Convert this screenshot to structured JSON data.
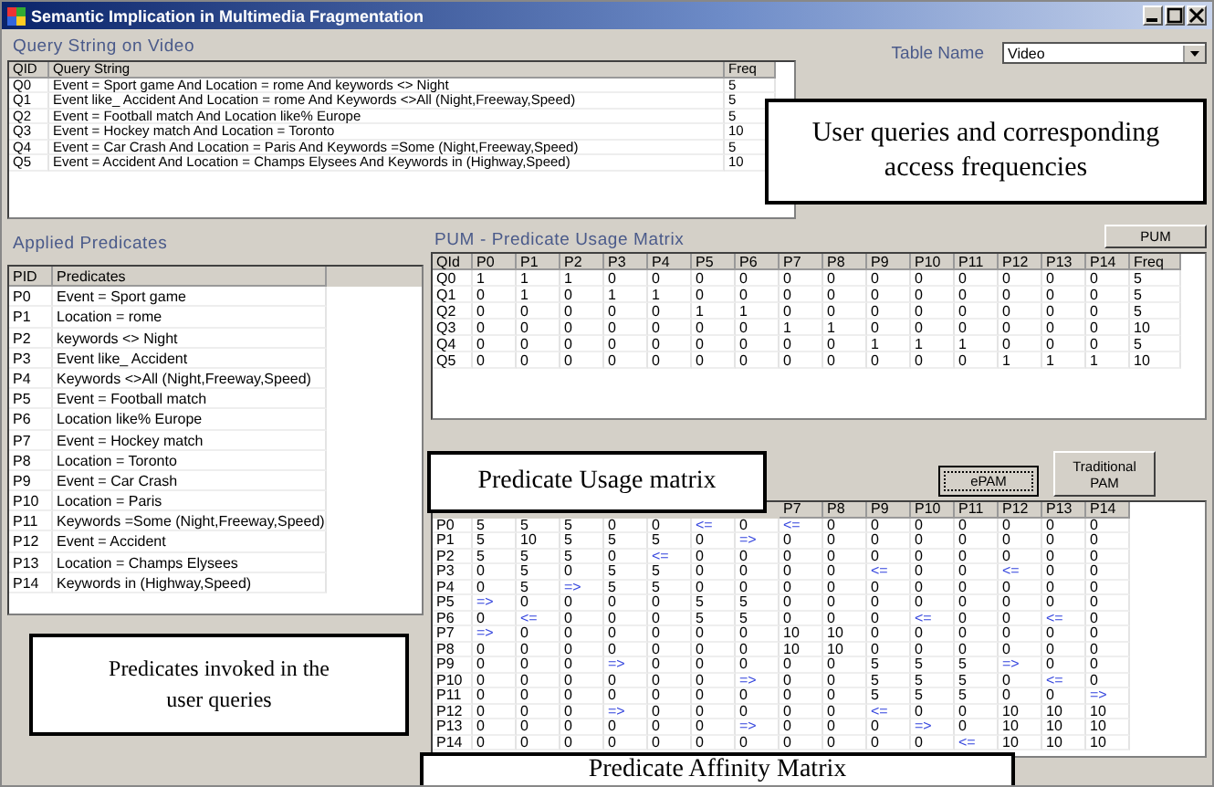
{
  "window": {
    "title": "Semantic Implication in Multimedia Fragmentation"
  },
  "query_section": {
    "title": "Query String on Video",
    "columns": [
      "QID",
      "Query String",
      "Freq"
    ],
    "rows": [
      [
        "Q0",
        "Event = Sport game And Location = rome And keywords <> Night",
        "5"
      ],
      [
        "Q1",
        "Event like_ Accident And Location = rome And  Keywords <>All (Night,Freeway,Speed)",
        "5"
      ],
      [
        "Q2",
        "Event = Football match And Location like% Europe",
        "5"
      ],
      [
        "Q3",
        "Event = Hockey match And Location = Toronto",
        "10"
      ],
      [
        "Q4",
        "Event = Car Crash And Location = Paris And  Keywords =Some (Night,Freeway,Speed)",
        "5"
      ],
      [
        "Q5",
        "Event = Accident And Location = Champs Elysees And Keywords in (Highway,Speed)",
        "10"
      ]
    ]
  },
  "table_name": {
    "label": "Table Name",
    "value": "Video"
  },
  "predicates_section": {
    "title": "Applied Predicates",
    "columns": [
      "PID",
      "Predicates"
    ],
    "rows": [
      [
        "P0",
        "Event = Sport game"
      ],
      [
        "P1",
        "Location = rome"
      ],
      [
        "P2",
        "keywords <> Night"
      ],
      [
        "P3",
        "Event like_ Accident"
      ],
      [
        "P4",
        "Keywords <>All (Night,Freeway,Speed)"
      ],
      [
        "P5",
        "Event = Football match"
      ],
      [
        "P6",
        "Location like% Europe"
      ],
      [
        "P7",
        "Event = Hockey match"
      ],
      [
        "P8",
        "Location = Toronto"
      ],
      [
        "P9",
        "Event = Car Crash"
      ],
      [
        "P10",
        "Location = Paris"
      ],
      [
        "P11",
        "Keywords =Some (Night,Freeway,Speed)"
      ],
      [
        "P12",
        "Event = Accident"
      ],
      [
        "P13",
        "Location = Champs Elysees"
      ],
      [
        "P14",
        "Keywords in (Highway,Speed)"
      ]
    ]
  },
  "pum_section": {
    "title": "PUM - Predicate Usage Matrix",
    "button": "PUM",
    "columns": [
      "QId",
      "P0",
      "P1",
      "P2",
      "P3",
      "P4",
      "P5",
      "P6",
      "P7",
      "P8",
      "P9",
      "P10",
      "P11",
      "P12",
      "P13",
      "P14",
      "Freq"
    ],
    "rows": [
      [
        "Q0",
        "1",
        "1",
        "1",
        "0",
        "0",
        "0",
        "0",
        "0",
        "0",
        "0",
        "0",
        "0",
        "0",
        "0",
        "0",
        "5"
      ],
      [
        "Q1",
        "0",
        "1",
        "0",
        "1",
        "1",
        "0",
        "0",
        "0",
        "0",
        "0",
        "0",
        "0",
        "0",
        "0",
        "0",
        "5"
      ],
      [
        "Q2",
        "0",
        "0",
        "0",
        "0",
        "0",
        "1",
        "1",
        "0",
        "0",
        "0",
        "0",
        "0",
        "0",
        "0",
        "0",
        "5"
      ],
      [
        "Q3",
        "0",
        "0",
        "0",
        "0",
        "0",
        "0",
        "0",
        "1",
        "1",
        "0",
        "0",
        "0",
        "0",
        "0",
        "0",
        "10"
      ],
      [
        "Q4",
        "0",
        "0",
        "0",
        "0",
        "0",
        "0",
        "0",
        "0",
        "0",
        "1",
        "1",
        "1",
        "0",
        "0",
        "0",
        "5"
      ],
      [
        "Q5",
        "0",
        "0",
        "0",
        "0",
        "0",
        "0",
        "0",
        "0",
        "0",
        "0",
        "0",
        "0",
        "1",
        "1",
        "1",
        "10"
      ]
    ]
  },
  "buttons": [
    "ePAM",
    "Traditional PAM"
  ],
  "pam_section": {
    "visible_columns": [
      "P7",
      "P8",
      "P9",
      "P10",
      "P11",
      "P12",
      "P13",
      "P14"
    ],
    "rows": [
      [
        "P0",
        "5",
        "5",
        "5",
        "0",
        "0",
        "<=",
        "0",
        "<=",
        "0",
        "0",
        "0",
        "0",
        "0",
        "0",
        "0"
      ],
      [
        "P1",
        "5",
        "10",
        "5",
        "5",
        "5",
        "0",
        "=>",
        "0",
        "0",
        "0",
        "0",
        "0",
        "0",
        "0",
        "0"
      ],
      [
        "P2",
        "5",
        "5",
        "5",
        "0",
        "<=",
        "0",
        "0",
        "0",
        "0",
        "0",
        "0",
        "0",
        "0",
        "0",
        "0"
      ],
      [
        "P3",
        "0",
        "5",
        "0",
        "5",
        "5",
        "0",
        "0",
        "0",
        "0",
        "<=",
        "0",
        "0",
        "<=",
        "0",
        "0"
      ],
      [
        "P4",
        "0",
        "5",
        "=>",
        "5",
        "5",
        "0",
        "0",
        "0",
        "0",
        "0",
        "0",
        "0",
        "0",
        "0",
        "0"
      ],
      [
        "P5",
        "=>",
        "0",
        "0",
        "0",
        "0",
        "5",
        "5",
        "0",
        "0",
        "0",
        "0",
        "0",
        "0",
        "0",
        "0"
      ],
      [
        "P6",
        "0",
        "<=",
        "0",
        "0",
        "0",
        "5",
        "5",
        "0",
        "0",
        "0",
        "<=",
        "0",
        "0",
        "<=",
        "0"
      ],
      [
        "P7",
        "=>",
        "0",
        "0",
        "0",
        "0",
        "0",
        "0",
        "10",
        "10",
        "0",
        "0",
        "0",
        "0",
        "0",
        "0"
      ],
      [
        "P8",
        "0",
        "0",
        "0",
        "0",
        "0",
        "0",
        "0",
        "10",
        "10",
        "0",
        "0",
        "0",
        "0",
        "0",
        "0"
      ],
      [
        "P9",
        "0",
        "0",
        "0",
        "=>",
        "0",
        "0",
        "0",
        "0",
        "0",
        "5",
        "5",
        "5",
        "=>",
        "0",
        "0"
      ],
      [
        "P10",
        "0",
        "0",
        "0",
        "0",
        "0",
        "0",
        "=>",
        "0",
        "0",
        "5",
        "5",
        "5",
        "0",
        "<=",
        "0"
      ],
      [
        "P11",
        "0",
        "0",
        "0",
        "0",
        "0",
        "0",
        "0",
        "0",
        "0",
        "5",
        "5",
        "5",
        "0",
        "0",
        "=>"
      ],
      [
        "P12",
        "0",
        "0",
        "0",
        "=>",
        "0",
        "0",
        "0",
        "0",
        "0",
        "<=",
        "0",
        "0",
        "10",
        "10",
        "10"
      ],
      [
        "P13",
        "0",
        "0",
        "0",
        "0",
        "0",
        "0",
        "=>",
        "0",
        "0",
        "0",
        "=>",
        "0",
        "10",
        "10",
        "10"
      ],
      [
        "P14",
        "0",
        "0",
        "0",
        "0",
        "0",
        "0",
        "0",
        "0",
        "0",
        "0",
        "0",
        "<=",
        "10",
        "10",
        "10"
      ]
    ]
  },
  "callouts": [
    "User queries and corresponding access frequencies",
    "Predicates invoked in the user queries",
    "Predicate Usage matrix",
    "Predicate Affinity Matrix"
  ]
}
